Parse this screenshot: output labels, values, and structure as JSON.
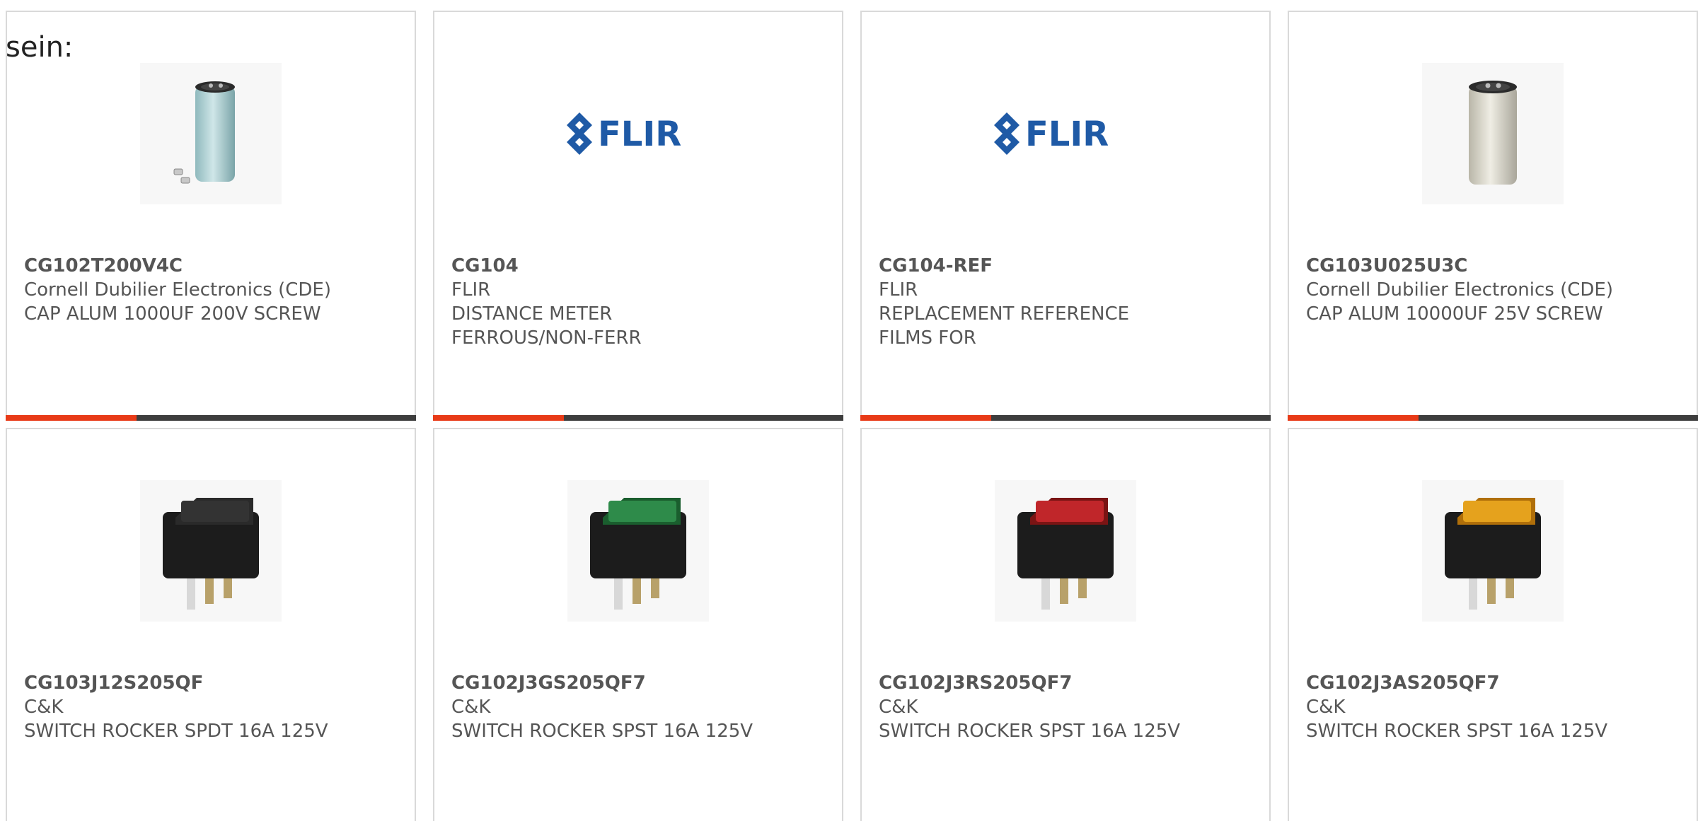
{
  "caption": "sein:",
  "colors": {
    "accent": "#e83a17",
    "bar": "#3d3d3d",
    "border": "#d9d9d9",
    "flir_blue": "#1f5aa6"
  },
  "cards": [
    {
      "part_number": "CG102T200V4C",
      "manufacturer": "Cornell Dubilier Electronics (CDE)",
      "description": [
        "CAP ALUM 1000UF 200V SCREW"
      ],
      "image": "capacitor-teal"
    },
    {
      "part_number": "CG104",
      "manufacturer": "FLIR",
      "description": [
        "DISTANCE METER",
        "FERROUS/NON-FERR"
      ],
      "image": "flir-logo",
      "logo_text": "FLIR"
    },
    {
      "part_number": "CG104-REF",
      "manufacturer": "FLIR",
      "description": [
        "REPLACEMENT REFERENCE",
        "FILMS FOR"
      ],
      "image": "flir-logo",
      "logo_text": "FLIR"
    },
    {
      "part_number": "CG103U025U3C",
      "manufacturer": "Cornell Dubilier Electronics (CDE)",
      "description": [
        "CAP ALUM 10000UF 25V SCREW"
      ],
      "image": "capacitor-silver"
    },
    {
      "part_number": "CG103J12S205QF",
      "manufacturer": "C&K",
      "description": [
        "SWITCH ROCKER SPDT 16A 125V"
      ],
      "image": "rocker-switch-black"
    },
    {
      "part_number": "CG102J3GS205QF7",
      "manufacturer": "C&K",
      "description": [
        "SWITCH ROCKER SPST 16A 125V"
      ],
      "image": "rocker-switch-green"
    },
    {
      "part_number": "CG102J3RS205QF7",
      "manufacturer": "C&K",
      "description": [
        "SWITCH ROCKER SPST 16A 125V"
      ],
      "image": "rocker-switch-red"
    },
    {
      "part_number": "CG102J3AS205QF7",
      "manufacturer": "C&K",
      "description": [
        "SWITCH ROCKER SPST 16A 125V"
      ],
      "image": "rocker-switch-amber"
    }
  ]
}
